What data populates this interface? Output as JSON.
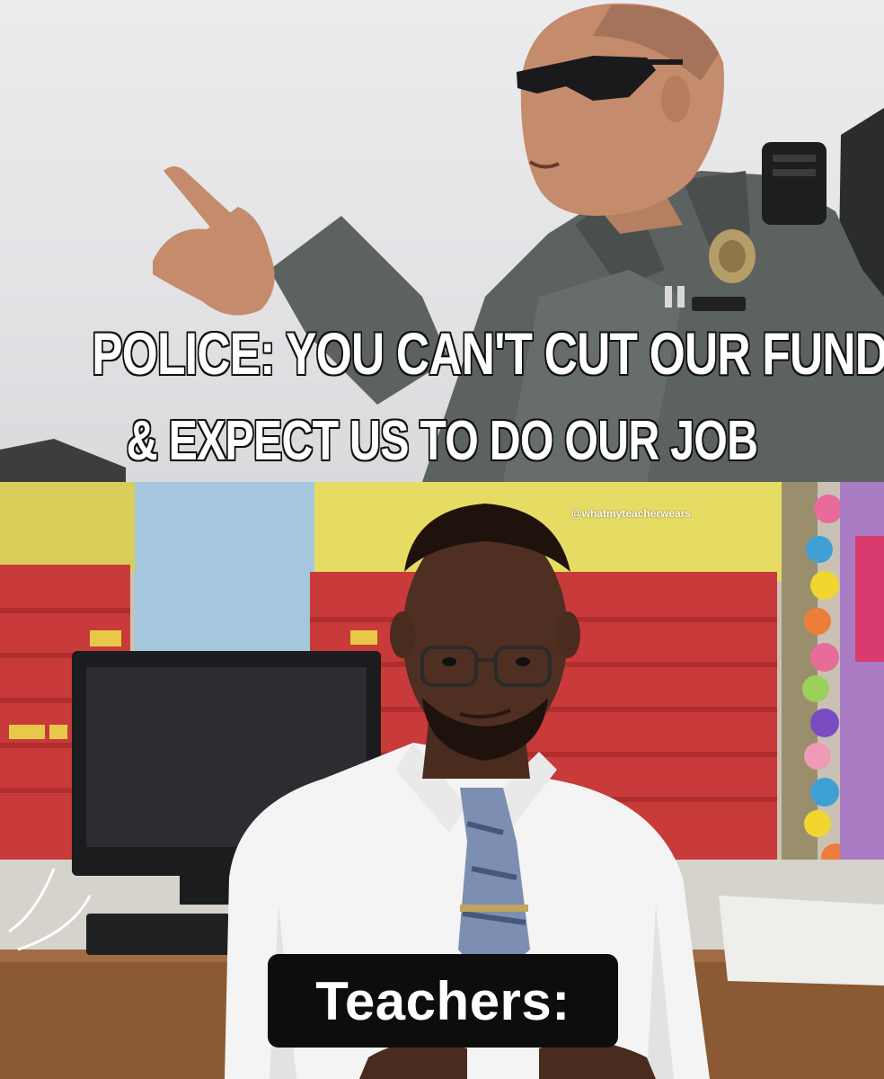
{
  "top_panel": {
    "caption_line1": "POLICE: YOU CAN'T CUT OUR FUNDING",
    "caption_line2": "& EXPECT US TO DO OUR JOB",
    "image_subject": "police-officer-pointing"
  },
  "bottom_panel": {
    "watermark": "@whatmyteacherwears",
    "caption": "Teachers:",
    "image_subject": "teacher-smirking-in-classroom"
  },
  "colors": {
    "caption_fill": "#ffffff",
    "caption_stroke": "#111111",
    "caption_box": "#0d0d0d",
    "uniform": "#5c6260",
    "board_red": "#c93a3a",
    "board_yellow": "#e7dc63"
  }
}
